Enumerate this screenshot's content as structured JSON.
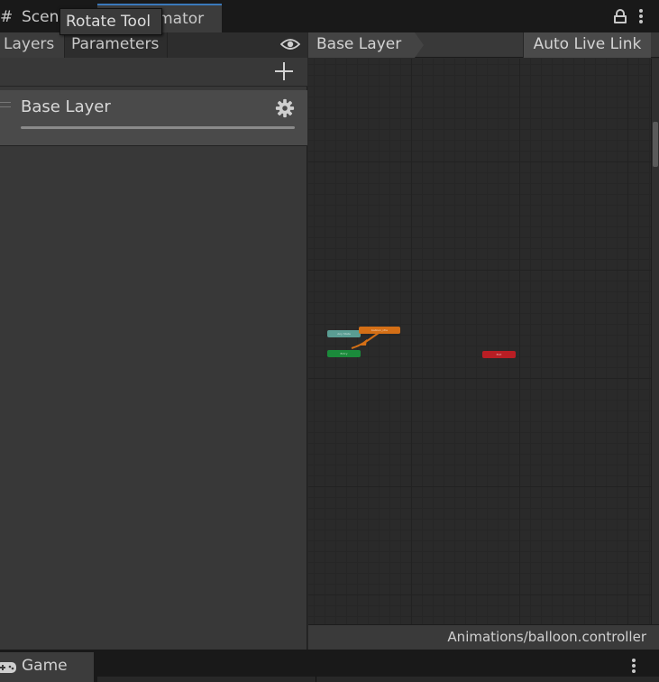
{
  "window_tabs": {
    "scene_label": "Scene",
    "animator_label": "Animator"
  },
  "tooltip": {
    "text": "Rotate Tool"
  },
  "left_panel": {
    "tabs": {
      "layers": "Layers",
      "parameters": "Parameters"
    },
    "layers": [
      {
        "name": "Base Layer",
        "weight": 1.0
      }
    ]
  },
  "graph": {
    "breadcrumb": "Base Layer",
    "auto_live_link": "Auto Live Link",
    "nodes": {
      "any_state": "Any State",
      "default_state": "balloon_idle",
      "entry": "Entry",
      "exit": "Exit"
    },
    "controller_path": "Animations/balloon.controller"
  },
  "bottom_window": {
    "game_label": "Game"
  },
  "colors": {
    "any_state": "#5a9d93",
    "default_state": "#d46f16",
    "entry": "#1b8a3b",
    "exit": "#b81e24",
    "active_tab_accent": "#3a79bb"
  }
}
